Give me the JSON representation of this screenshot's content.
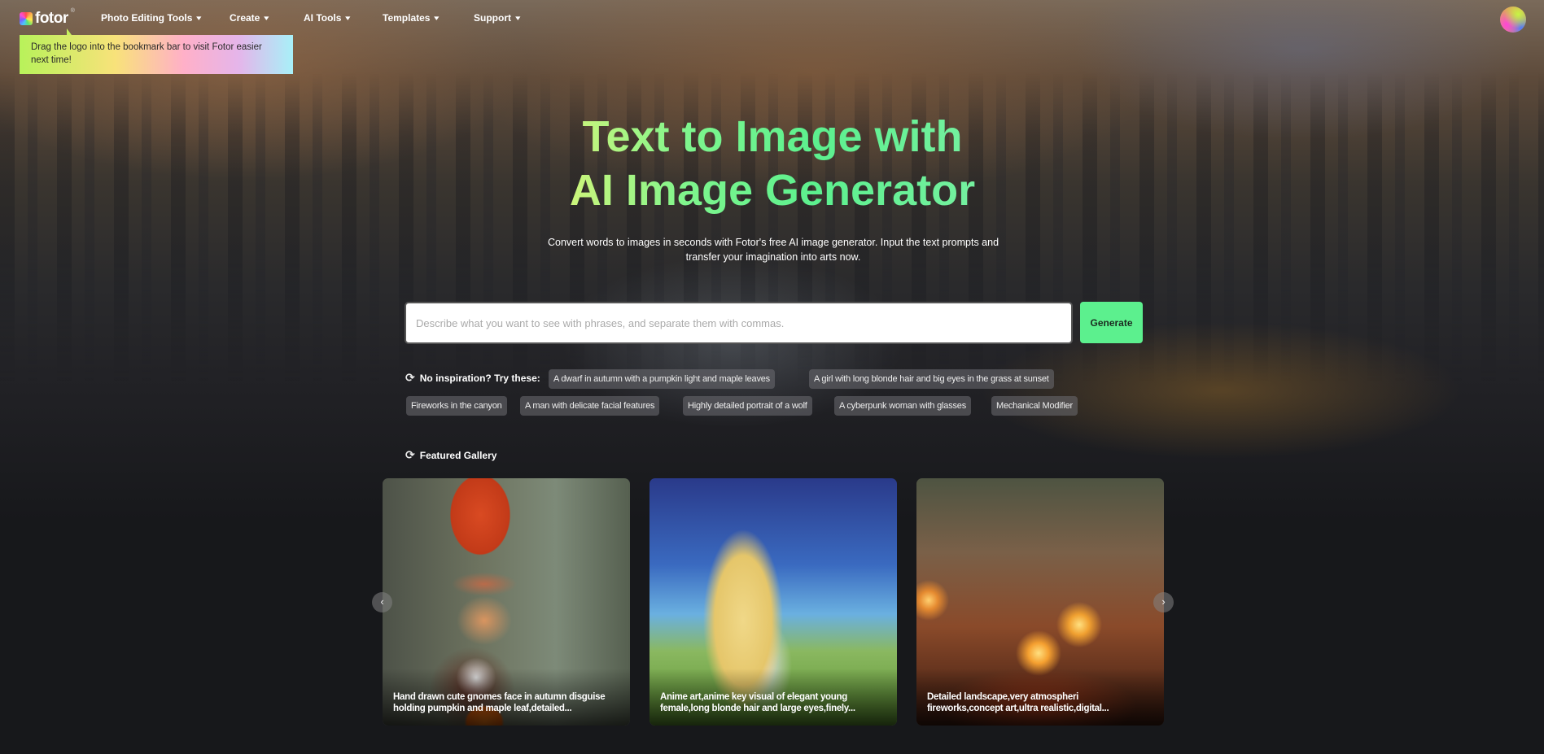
{
  "nav": {
    "logo_text": "fotor",
    "logo_reg": "®",
    "items": [
      {
        "label": "Photo Editing Tools",
        "chevron": "▾"
      },
      {
        "label": "Create",
        "chevron": "▾"
      },
      {
        "label": "AI Tools",
        "chevron": "▾"
      },
      {
        "label": "Templates",
        "chevron": "▾"
      },
      {
        "label": "Support",
        "chevron": "▾"
      }
    ]
  },
  "tooltip": {
    "text": "Drag the logo into the bookmark bar to visit Fotor easier next time!"
  },
  "hero": {
    "title_line1": "Text to Image with",
    "title_line2": "AI Image Generator",
    "subtitle": "Convert words to images in seconds with Fotor's free AI image generator. Input the text prompts and transfer your imagination into arts now."
  },
  "search": {
    "value": "",
    "placeholder": "Describe what you want to see with phrases, and separate them with commas.",
    "generate_label": "Generate"
  },
  "inspiration": {
    "icon": "⟳",
    "label": "No inspiration? Try these:",
    "chips": [
      "A dwarf in autumn with a pumpkin light and maple leaves",
      "A girl with long blonde hair and big eyes in the grass at sunset",
      "Fireworks in the canyon",
      "A man with delicate facial features",
      "Highly detailed portrait of a wolf",
      "A cyberpunk woman with glasses",
      "Mechanical Modifier"
    ]
  },
  "gallery": {
    "icon": "⟳",
    "label": "Featured Gallery",
    "prev_icon": "‹",
    "next_icon": "›",
    "cards": [
      {
        "caption": "Hand drawn cute gnomes face in autumn disguise holding pumpkin and maple leaf,detailed..."
      },
      {
        "caption": "Anime art,anime key visual of elegant young female,long blonde hair and large eyes,finely..."
      },
      {
        "caption": "Detailed landscape,very atmospheri fireworks,concept art,ultra realistic,digital..."
      }
    ]
  },
  "colors": {
    "accent_green": "#5cf08e",
    "background": "#17181b"
  }
}
